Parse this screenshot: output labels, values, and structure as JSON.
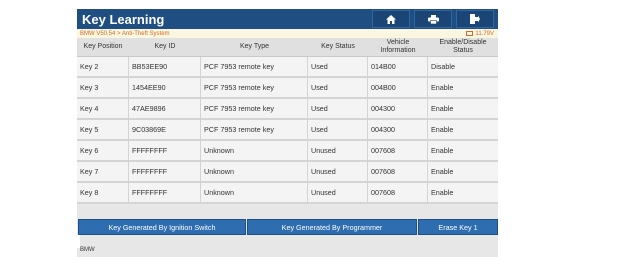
{
  "titlebar": {
    "title": "Key Learning",
    "icons": [
      "home-icon",
      "print-icon",
      "exit-icon"
    ]
  },
  "subbar": {
    "breadcrumb": "BMW V50.54 > Anti-Theft System",
    "voltage": "11.79V"
  },
  "table": {
    "headers": [
      "Key Position",
      "Key ID",
      "Key Type",
      "Key Status",
      "Vehicle Information",
      "Enable/Disable Status"
    ],
    "rows": [
      [
        "Key 2",
        "BB53EE90",
        "PCF 7953 remote key",
        "Used",
        "014B00",
        "Disable"
      ],
      [
        "Key 3",
        "1454EE90",
        "PCF 7953 remote key",
        "Used",
        "004B00",
        "Enable"
      ],
      [
        "Key 4",
        "47AE9896",
        "PCF 7953 remote key",
        "Used",
        "004300",
        "Enable"
      ],
      [
        "Key 5",
        "9C03869E",
        "PCF 7953 remote key",
        "Used",
        "004300",
        "Enable"
      ],
      [
        "Key 6",
        "FFFFFFFF",
        "Unknown",
        "Unused",
        "007608",
        "Enable"
      ],
      [
        "Key 7",
        "FFFFFFFF",
        "Unknown",
        "Unused",
        "007608",
        "Enable"
      ],
      [
        "Key 8",
        "FFFFFFFF",
        "Unknown",
        "Unused",
        "007608",
        "Enable"
      ]
    ]
  },
  "buttons": {
    "ignition": "Key Generated By Ignition Switch",
    "programmer": "Key Generated By Programmer",
    "erase": "Erase Key 1"
  },
  "footer": {
    "label": "BMW"
  },
  "colors": {
    "header": "#1f4e82",
    "button": "#2e6db0",
    "breadcrumb": "#d26a2a"
  }
}
